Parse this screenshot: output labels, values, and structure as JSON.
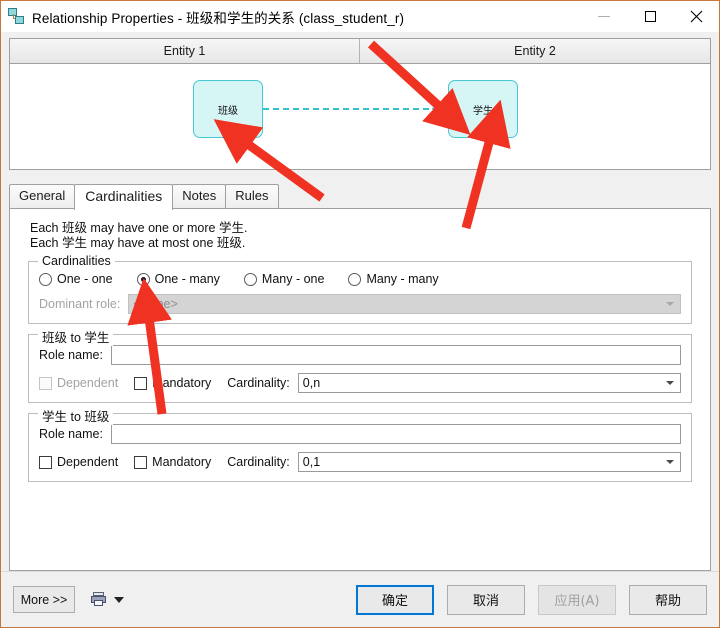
{
  "window": {
    "title": "Relationship Properties - 班级和学生的关系 (class_student_r)",
    "icon": "relationship-icon",
    "minimize_label": "—",
    "maximize_label": "□",
    "close_label": "✕"
  },
  "preview": {
    "entity1_header": "Entity 1",
    "entity2_header": "Entity 2",
    "entity1_name": "班级",
    "entity2_name": "学生",
    "entity_fill": "#d6f6f6",
    "entity_border": "#45c8d4",
    "connector_style": "dashed",
    "connector_color": "#32c2cf",
    "connector_end": "crows-foot"
  },
  "tabs": [
    {
      "label": "General",
      "active": false
    },
    {
      "label": "Cardinalities",
      "active": true
    },
    {
      "label": "Notes",
      "active": false
    },
    {
      "label": "Rules",
      "active": false
    }
  ],
  "description": {
    "line1": "Each 班级 may have one or more 学生.",
    "line2": "Each 学生 may have at most one 班级."
  },
  "cardinalities": {
    "legend": "Cardinalities",
    "options": [
      {
        "label": "One - one",
        "selected": false
      },
      {
        "label": "One - many",
        "selected": true
      },
      {
        "label": "Many - one",
        "selected": false
      },
      {
        "label": "Many - many",
        "selected": false
      }
    ],
    "dominant_role_label": "Dominant role:",
    "dominant_role_value": "<None>",
    "dominant_role_enabled": false
  },
  "forward": {
    "legend": "班级 to 学生",
    "role_name_label": "Role name:",
    "role_name_value": "",
    "dependent_label": "Dependent",
    "dependent_checked": false,
    "dependent_enabled": false,
    "mandatory_label": "Mandatory",
    "mandatory_checked": false,
    "cardinality_label": "Cardinality:",
    "cardinality_value": "0,n"
  },
  "reverse": {
    "legend": "学生 to 班级",
    "role_name_label": "Role name:",
    "role_name_value": "",
    "dependent_label": "Dependent",
    "dependent_checked": false,
    "dependent_enabled": true,
    "mandatory_label": "Mandatory",
    "mandatory_checked": false,
    "cardinality_label": "Cardinality:",
    "cardinality_value": "0,1"
  },
  "footer": {
    "more_label": "More >>",
    "print_icon": "printer-icon",
    "print_dropdown_icon": "chevron-down-icon",
    "ok_label": "确定",
    "cancel_label": "取消",
    "apply_label": "应用(A)",
    "apply_enabled": false,
    "help_label": "帮助",
    "default_button_color": "#0078d7"
  },
  "annotations": {
    "arrow_color": "#f03223",
    "count": 4
  }
}
